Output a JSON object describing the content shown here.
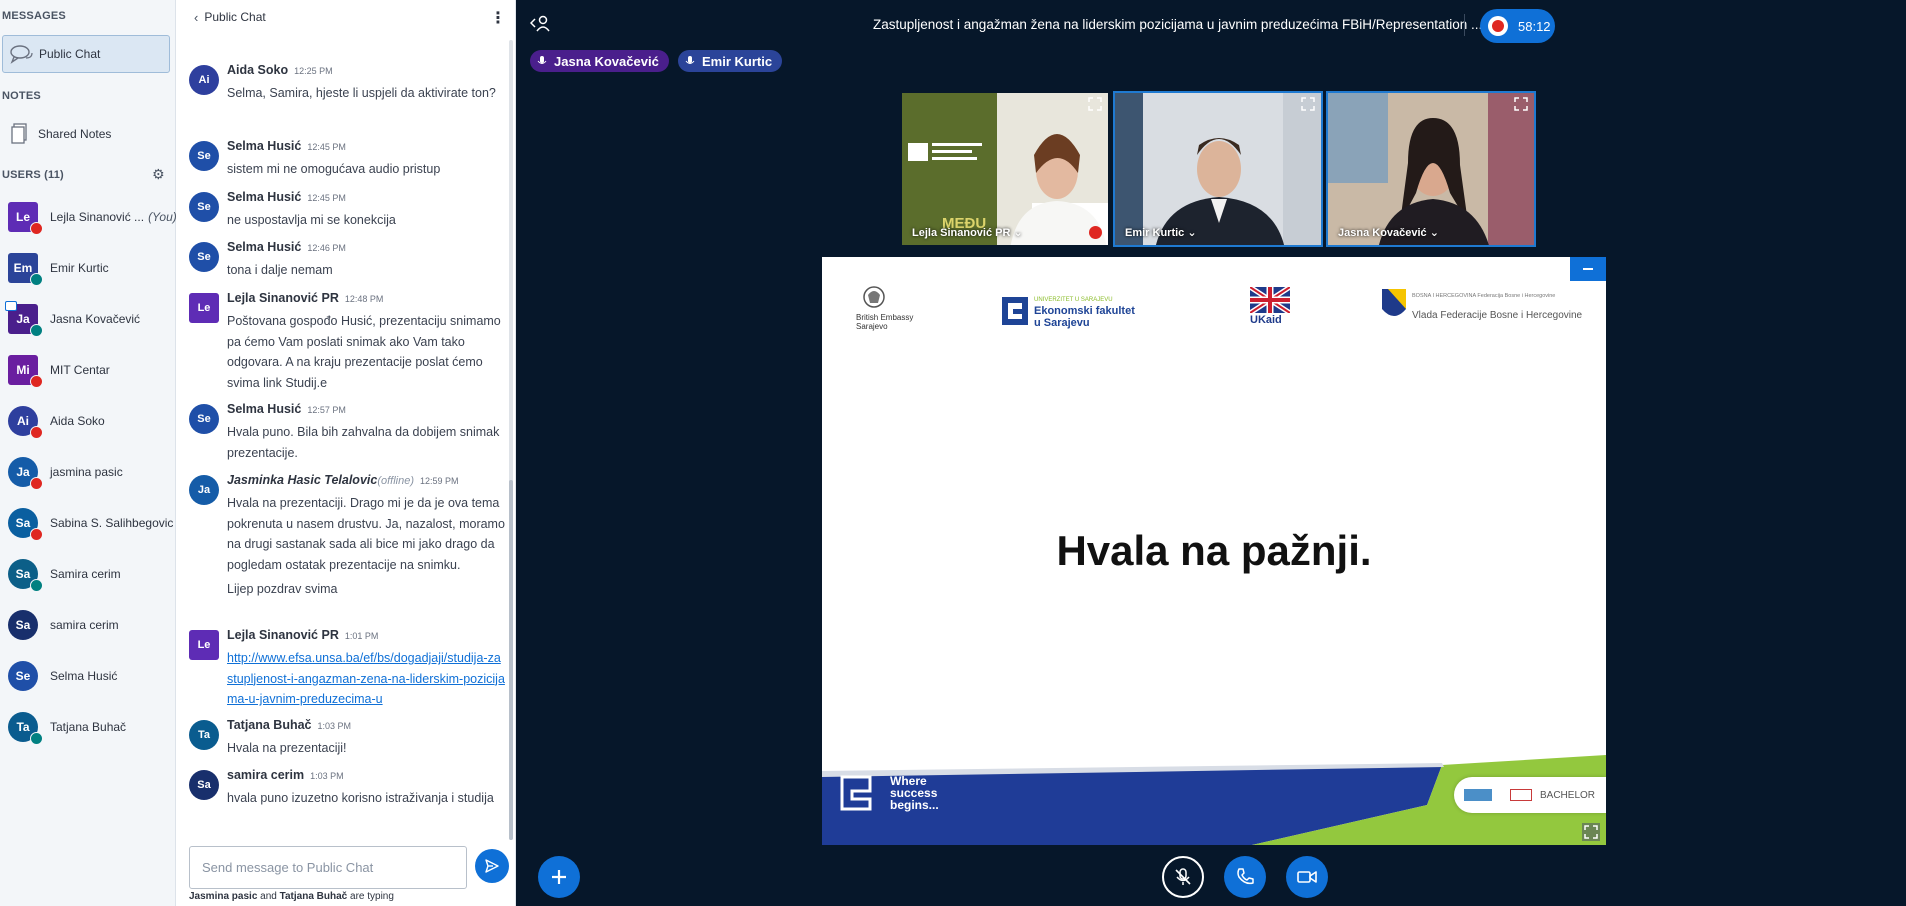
{
  "sidebar": {
    "messages_title": "MESSAGES",
    "public_chat": "Public Chat",
    "notes_title": "NOTES",
    "shared_notes": "Shared Notes",
    "users_title": "USERS (11)",
    "users": [
      {
        "initials": "Le",
        "name": "Lejla Sinanović ...",
        "you": "(You)",
        "color": "#5e2cb5",
        "shape": "sq",
        "status": "mut"
      },
      {
        "initials": "Em",
        "name": "Emir Kurtic",
        "you": "",
        "color": "#2b4499",
        "shape": "sq",
        "status": "on"
      },
      {
        "initials": "Ja",
        "name": "Jasna Kovačević",
        "you": "",
        "color": "#4a1f8c",
        "shape": "sq",
        "status": "on"
      },
      {
        "initials": "Mi",
        "name": "MIT Centar",
        "you": "",
        "color": "#6a1ea0",
        "shape": "sq",
        "status": "mut"
      },
      {
        "initials": "Ai",
        "name": "Aida Soko",
        "you": "",
        "color": "#2e3f9e",
        "shape": "ci",
        "status": "mut"
      },
      {
        "initials": "Ja",
        "name": "jasmina pasic",
        "you": "",
        "color": "#155ca8",
        "shape": "ci",
        "status": "mut"
      },
      {
        "initials": "Sa",
        "name": "Sabina S. Salihbegovic",
        "you": "",
        "color": "#0a5fa0",
        "shape": "ci",
        "status": "mut"
      },
      {
        "initials": "Sa",
        "name": "Samira cerim",
        "you": "",
        "color": "#0c5f88",
        "shape": "ci",
        "status": "on"
      },
      {
        "initials": "Sa",
        "name": "samira cerim",
        "you": "",
        "color": "#182f6c",
        "shape": "ci",
        "status": ""
      },
      {
        "initials": "Se",
        "name": "Selma Husić",
        "you": "",
        "color": "#1f4fa8",
        "shape": "ci",
        "status": ""
      },
      {
        "initials": "Ta",
        "name": "Tatjana Buhač",
        "you": "",
        "color": "#0a5c8f",
        "shape": "ci",
        "status": "on"
      }
    ]
  },
  "chat": {
    "title": "Public Chat",
    "messages": [
      {
        "initials": "Ai",
        "name": "Aida Soko",
        "offline": "",
        "time": "12:25 PM",
        "text": "Selma, Samira, hjeste li uspjeli da aktivirate ton?",
        "color": "#2e3f9e",
        "shape": "ci",
        "italic": false
      },
      {
        "initials": "Se",
        "name": "Selma Husić",
        "offline": "",
        "time": "12:45 PM",
        "text": "sistem mi ne omogućava audio pristup",
        "color": "#1f4fa8",
        "shape": "ci",
        "italic": false
      },
      {
        "initials": "Se",
        "name": "Selma Husić",
        "offline": "",
        "time": "12:45 PM",
        "text": "ne uspostavlja mi se konekcija",
        "color": "#1f4fa8",
        "shape": "ci",
        "italic": false
      },
      {
        "initials": "Se",
        "name": "Selma Husić",
        "offline": "",
        "time": "12:46 PM",
        "text": "tona i dalje nemam",
        "color": "#1f4fa8",
        "shape": "ci",
        "italic": false
      },
      {
        "initials": "Le",
        "name": "Lejla Sinanović PR",
        "offline": "",
        "time": "12:48 PM",
        "text": "Poštovana gospođo Husić, prezentaciju snimamo pa ćemo Vam poslati snimak ako Vam tako odgovara. A na kraju prezentacije poslat ćemo svima link Studij.e",
        "color": "#5e2cb5",
        "shape": "sq",
        "italic": false
      },
      {
        "initials": "Se",
        "name": "Selma Husić",
        "offline": "",
        "time": "12:57 PM",
        "text": "Hvala puno. Bila bih zahvalna da dobijem snimak prezentacije.",
        "color": "#1f4fa8",
        "shape": "ci",
        "italic": false
      },
      {
        "initials": "Ja",
        "name": "Jasminka Hasic Telalovic",
        "offline": "(offline)",
        "time": "12:59 PM",
        "text": "Hvala na prezentaciji. Drago mi je da je ova tema pokrenuta u nasem drustvu. Ja, nazalost, moramo na drugi sastanak sada ali bice mi jako drago da pogledam ostatak prezentacije na snimku.",
        "extra": "Lijep pozdrav svima",
        "color": "#155ca8",
        "shape": "ci",
        "italic": true
      },
      {
        "initials": "Le",
        "name": "Lejla Sinanović PR",
        "offline": "",
        "time": "1:01 PM",
        "link": "http://www.efsa.unsa.ba/ef/bs/dogadjaji/studija-zastupljenost-i-angazman-zena-na-liderskim-pozicijama-u-javnim-preduzecima-u",
        "color": "#5e2cb5",
        "shape": "sq",
        "italic": false
      },
      {
        "initials": "Ta",
        "name": "Tatjana Buhač",
        "offline": "",
        "time": "1:03 PM",
        "text": "Hvala na prezentaciji!",
        "color": "#0a5c8f",
        "shape": "ci",
        "italic": false
      },
      {
        "initials": "Sa",
        "name": "samira cerim",
        "offline": "",
        "time": "1:03 PM",
        "text": "hvala puno izuzetno korisno istraživanja i studija",
        "color": "#182f6c",
        "shape": "ci",
        "italic": false
      }
    ],
    "input_placeholder": "Send message to Public Chat",
    "typing_user1": "Jasmina pasic",
    "typing_and": "and",
    "typing_user2": "Tatjana Buhač",
    "typing_suffix": "are typing"
  },
  "main": {
    "meeting_title": "Zastupljenost i angažman žena na liderskim pozicijama u javnim preduzećima FBiH/Representation ...",
    "recording_time": "58:12",
    "talkers": [
      {
        "name": "Jasna Kovačević",
        "color": "#4a1f8c"
      },
      {
        "name": "Emir Kurtic",
        "color": "#2b4499"
      }
    ],
    "videos": [
      {
        "name": "Lejla Sinanović PR ⌄"
      },
      {
        "name": "Emir Kurtic ⌄"
      },
      {
        "name": "Jasna Kovačević ⌄"
      }
    ],
    "slide": {
      "heading": "Hvala na pažnji.",
      "logo1": "British Embassy Sarajevo",
      "logo2_top": "UNIVERZITET U SARAJEVU",
      "logo2_name": "Ekonomski fakultet u Sarajevu",
      "logo3": "UKaid",
      "logo4_small": "BOSNA I HERCEGOVINA Federacija Bosne i Hercegovine",
      "logo4_name": "Vlada Federacije Bosne i Hercegovine",
      "footer_tagline": "Where success begins...",
      "footer_right": "BACHELOR",
      "video_brand": "MEĐU"
    }
  }
}
